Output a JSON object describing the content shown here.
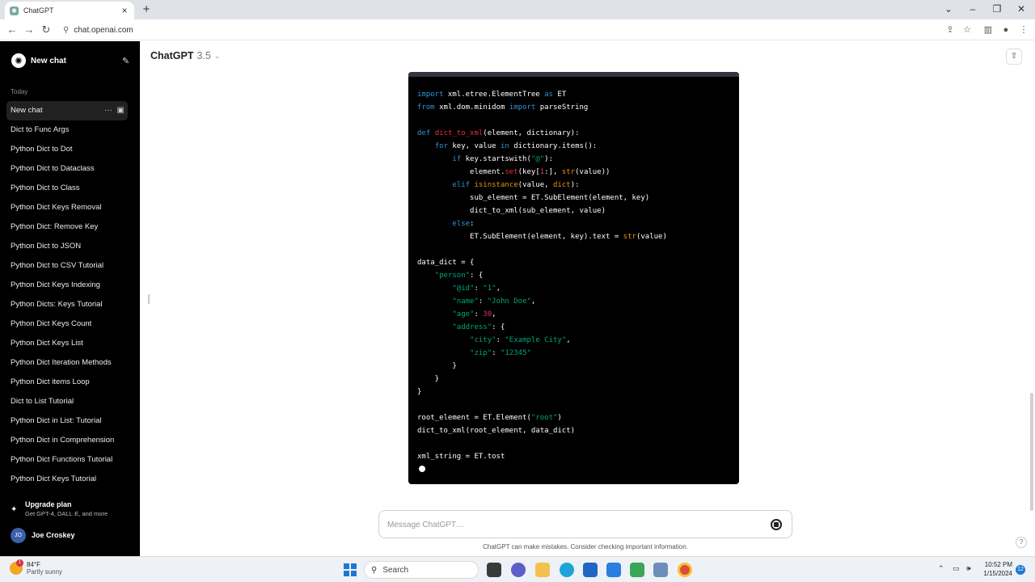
{
  "browser": {
    "tab_title": "ChatGPT",
    "url": "chat.openai.com"
  },
  "sidebar": {
    "new_chat": "New chat",
    "section": "Today",
    "items": [
      {
        "label": "New chat",
        "active": true
      },
      {
        "label": "Dict to Func Args"
      },
      {
        "label": "Python Dict to Dot"
      },
      {
        "label": "Python Dict to Dataclass"
      },
      {
        "label": "Python Dict to Class"
      },
      {
        "label": "Python Dict Keys Removal"
      },
      {
        "label": "Python Dict: Remove Key"
      },
      {
        "label": "Python Dict to JSON"
      },
      {
        "label": "Python Dict to CSV Tutorial"
      },
      {
        "label": "Python Dict Keys Indexing"
      },
      {
        "label": "Python Dicts: Keys Tutorial"
      },
      {
        "label": "Python Dict Keys Count"
      },
      {
        "label": "Python Dict Keys List"
      },
      {
        "label": "Python Dict Iteration Methods"
      },
      {
        "label": "Python Dict items Loop"
      },
      {
        "label": "Dict to List Tutorial"
      },
      {
        "label": "Python Dict in List: Tutorial"
      },
      {
        "label": "Python Dict in Comprehension"
      },
      {
        "label": "Python Dict Functions Tutorial"
      },
      {
        "label": "Python Dict Keys Tutorial"
      }
    ],
    "upgrade_title": "Upgrade plan",
    "upgrade_sub": "Get GPT-4, DALL·E, and more",
    "user_initials": "JO",
    "user_name": "Joe Croskey"
  },
  "header": {
    "model": "ChatGPT",
    "version": "3.5"
  },
  "code": {
    "language": "python",
    "lines": [
      "import xml.etree.ElementTree as ET",
      "from xml.dom.minidom import parseString",
      "",
      "def dict_to_xml(element, dictionary):",
      "    for key, value in dictionary.items():",
      "        if key.startswith(\"@\"):",
      "            element.set(key[1:], str(value))",
      "        elif isinstance(value, dict):",
      "            sub_element = ET.SubElement(element, key)",
      "            dict_to_xml(sub_element, value)",
      "        else:",
      "            ET.SubElement(element, key).text = str(value)",
      "",
      "data_dict = {",
      "    \"person\": {",
      "        \"@id\": \"1\",",
      "        \"name\": \"John Doe\",",
      "        \"age\": 30,",
      "        \"address\": {",
      "            \"city\": \"Example City\",",
      "            \"zip\": \"12345\"",
      "        }",
      "    }",
      "}",
      "",
      "root_element = ET.Element(\"root\")",
      "dict_to_xml(root_element, data_dict)",
      "",
      "xml_string = ET.tost"
    ]
  },
  "composer": {
    "placeholder": "Message ChatGPT…",
    "disclaimer": "ChatGPT can make mistakes. Consider checking important information."
  },
  "taskbar": {
    "temp": "84°F",
    "condition": "Partly sunny",
    "weather_badge": "1",
    "search": "Search",
    "time": "10:52 PM",
    "date": "1/15/2024",
    "notif_count": "12"
  }
}
